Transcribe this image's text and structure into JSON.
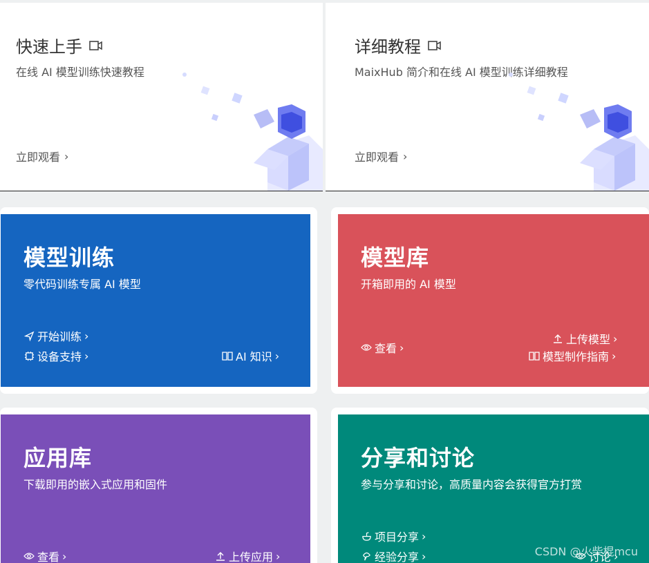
{
  "top_cards": [
    {
      "title": "快速上手",
      "subtitle": "在线 AI 模型训练快速教程",
      "link": "立即观看"
    },
    {
      "title": "详细教程",
      "subtitle": "MaixHub 简介和在线 AI 模型训练详细教程",
      "link": "立即观看"
    }
  ],
  "tiles": {
    "training": {
      "title": "模型训练",
      "desc": "零代码训练专属 AI 模型",
      "start": "开始训练",
      "devices": "设备支持",
      "knowledge": "AI 知识",
      "color": "#1565c0"
    },
    "models": {
      "title": "模型库",
      "desc": "开箱即用的 AI 模型",
      "view": "查看",
      "upload": "上传模型",
      "guide": "模型制作指南",
      "color": "#d9525a"
    },
    "apps": {
      "title": "应用库",
      "desc": "下载即用的嵌入式应用和固件",
      "view": "查看",
      "upload": "上传应用",
      "color": "#7a4fb8"
    },
    "share": {
      "title": "分享和讨论",
      "desc": "参与分享和讨论，高质量内容会获得官方打赏",
      "project": "项目分享",
      "experience": "经验分享",
      "discuss": "讨论",
      "color": "#00897b"
    }
  },
  "chevron": "›",
  "watermark": "CSDN @火柴棍mcu"
}
